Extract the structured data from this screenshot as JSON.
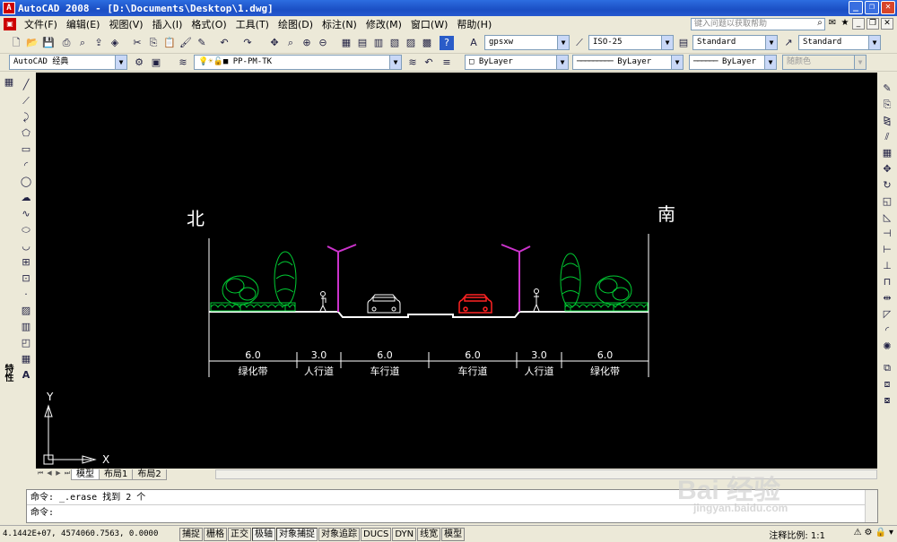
{
  "window": {
    "title": "AutoCAD 2008 - [D:\\Documents\\Desktop\\1.dwg]",
    "app_badge": "A"
  },
  "menubar": {
    "items": [
      "文件(F)",
      "编辑(E)",
      "视图(V)",
      "插入(I)",
      "格式(O)",
      "工具(T)",
      "绘图(D)",
      "标注(N)",
      "修改(M)",
      "窗口(W)",
      "帮助(H)"
    ],
    "help_placeholder": "键入问题以获取帮助"
  },
  "toolbar1": {
    "text_style": "gpsxw",
    "dim_style": "ISO-25",
    "table_style": "Standard",
    "multileader_style": "Standard"
  },
  "toolbar2": {
    "workspace": "AutoCAD 经典",
    "layer": "PP-PM-TK",
    "color": "ByLayer",
    "linetype": "ByLayer",
    "lineweight": "ByLayer",
    "plotstyle": "随颜色"
  },
  "left_panel": {
    "vertical_label": "特性"
  },
  "drawing": {
    "north_label": "北",
    "south_label": "南",
    "segments": [
      {
        "width": "6.0",
        "name": "绿化带"
      },
      {
        "width": "3.0",
        "name": "人行道"
      },
      {
        "width": "6.0",
        "name": "车行道"
      },
      {
        "width": "6.0",
        "name": "车行道"
      },
      {
        "width": "3.0",
        "name": "人行道"
      },
      {
        "width": "6.0",
        "name": "绿化带"
      }
    ],
    "ucs_x": "X",
    "ucs_y": "Y",
    "colors": {
      "background": "#000000",
      "tree": "#00cc33",
      "lamp": "#cc33cc",
      "car_left": "#ffffff",
      "car_right": "#ff2222"
    }
  },
  "layout_tabs": [
    "模型",
    "布局1",
    "布局2"
  ],
  "command": {
    "history": "命令: _.erase 找到 2 个",
    "prompt": "命令:"
  },
  "statusbar": {
    "coords": "4.1442E+07, 4574060.7563, 0.0000",
    "toggles": [
      "捕捉",
      "栅格",
      "正交",
      "极轴",
      "对象捕捉",
      "对象追踪",
      "DUCS",
      "DYN",
      "线宽",
      "模型"
    ],
    "scale_label": "注释比例: 1:1"
  },
  "watermark": {
    "main": "Bai 经验",
    "sub": "jingyan.baidu.com"
  }
}
